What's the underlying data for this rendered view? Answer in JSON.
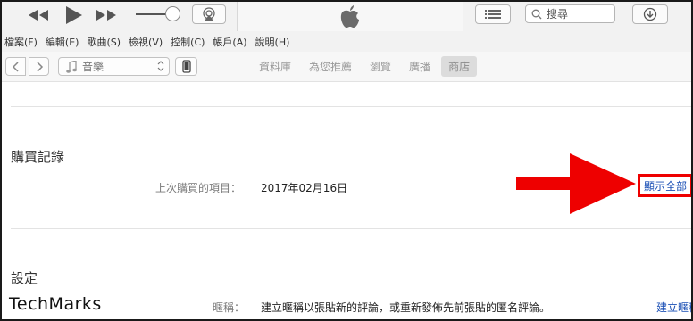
{
  "toolbar": {
    "prev_icon": "rewind-icon",
    "play_icon": "play-icon",
    "next_icon": "fast-forward-icon",
    "airplay_icon": "airplay-icon",
    "apple_logo": "apple-logo",
    "list_icon": "list-view-icon",
    "search_placeholder": "搜尋",
    "download_icon": "download-icon"
  },
  "menu": {
    "items": [
      "檔案(F)",
      "編輯(E)",
      "歌曲(S)",
      "檢視(V)",
      "控制(C)",
      "帳戶(A)",
      "說明(H)"
    ]
  },
  "nav": {
    "media_selector_label": "音樂",
    "tabs": [
      "資料庫",
      "為您推薦",
      "瀏覽",
      "廣播",
      "商店"
    ],
    "active_tab": "商店"
  },
  "purchase_history": {
    "title": "購買記錄",
    "last_purchase_label": "上次購買的項目：",
    "last_purchase_value": "2017年02月16日",
    "show_all_label": "顯示全部"
  },
  "settings": {
    "title": "設定",
    "nickname_label": "暱稱：",
    "nickname_value": "建立暱稱以張貼新的評論，或重新發佈先前張貼的匿名評論。",
    "create_nickname_label": "建立暱稱"
  },
  "watermark": {
    "text": "TechMarks"
  },
  "colors": {
    "annotation_red": "#ee0000",
    "link_blue": "#1a4fb5",
    "toolbar_bg": "#f2f2f2"
  }
}
